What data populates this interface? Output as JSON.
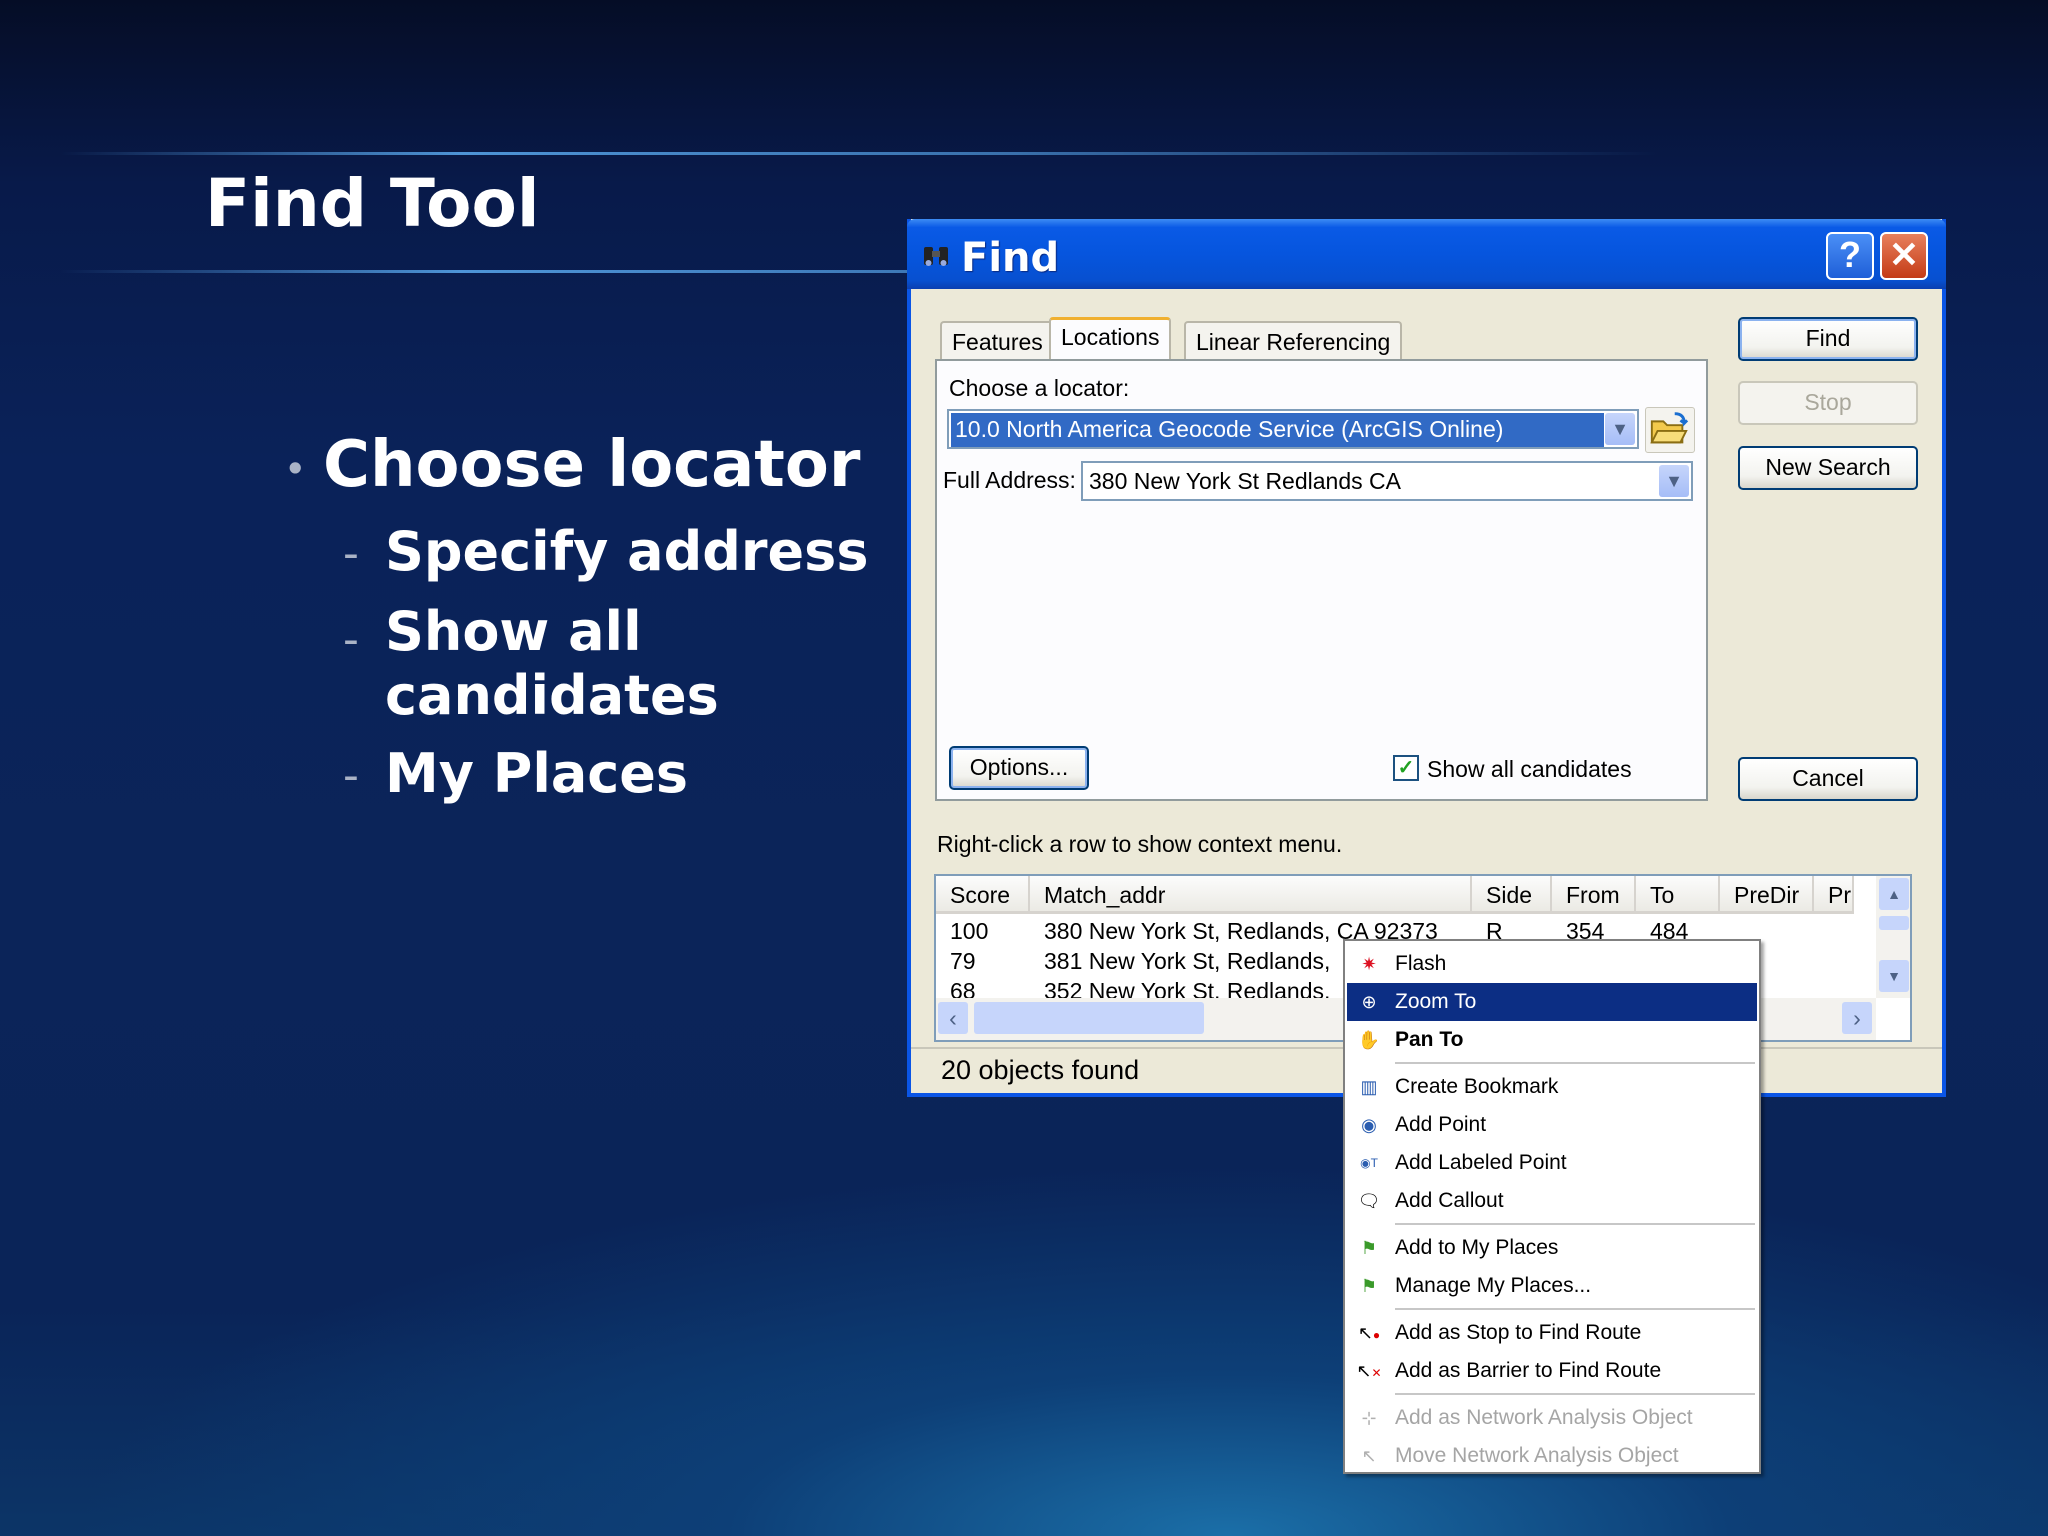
{
  "slide": {
    "title": "Find Tool",
    "bullets": {
      "main": "Choose locator",
      "sub1": "Specify address",
      "sub2a": "Show all",
      "sub2b": "candidates",
      "sub3": "My Places"
    }
  },
  "dialog": {
    "title": "Find",
    "help": "?",
    "close": "✕",
    "tabs": [
      "Features",
      "Locations",
      "Linear Referencing"
    ],
    "choose_locator_label": "Choose a locator:",
    "locator_value": "10.0 North America Geocode Service (ArcGIS Online)",
    "full_address_label": "Full Address:",
    "full_address_value": "380 New York St Redlands CA",
    "options_button": "Options...",
    "show_all_candidates": "Show all candidates",
    "show_all_checked": true,
    "buttons": {
      "find": "Find",
      "stop": "Stop",
      "new_search": "New Search",
      "cancel": "Cancel"
    },
    "hint": "Right-click a row to show context menu.",
    "columns": [
      "Score",
      "Match_addr",
      "Side",
      "From",
      "To",
      "PreDir",
      "Pre"
    ],
    "rows": [
      [
        "100",
        "380 New York St, Redlands, CA 92373",
        "R",
        "354",
        "484"
      ],
      [
        "79",
        "381 New York St, Redlands,",
        "",
        "",
        ""
      ],
      [
        "68",
        "352 New York St, Redlands,",
        "",
        "",
        ""
      ]
    ],
    "status": "20 objects found"
  },
  "context_menu": {
    "items": [
      {
        "label": "Flash",
        "icon": "flash-icon"
      },
      {
        "label": "Zoom To",
        "icon": "zoom-in-icon",
        "highlighted": true
      },
      {
        "label": "Pan To",
        "icon": "pan-hand-icon",
        "bold": true
      },
      {
        "label": "Create Bookmark",
        "icon": "bookmark-icon"
      },
      {
        "label": "Add Point",
        "icon": "point-icon"
      },
      {
        "label": "Add Labeled Point",
        "icon": "labeled-point-icon"
      },
      {
        "label": "Add Callout",
        "icon": "callout-icon"
      },
      {
        "label": "Add to My Places",
        "icon": "add-place-flag-icon"
      },
      {
        "label": "Manage My Places...",
        "icon": "place-flag-icon"
      },
      {
        "label": "Add as Stop to Find Route",
        "icon": "route-stop-icon"
      },
      {
        "label": "Add as Barrier to Find Route",
        "icon": "route-barrier-icon"
      },
      {
        "label": "Add as Network Analysis Object",
        "icon": "network-add-icon",
        "disabled": true
      },
      {
        "label": "Move Network Analysis Object",
        "icon": "network-move-icon",
        "disabled": true
      }
    ]
  },
  "colors": {
    "titlebar": "#0655de",
    "menu_highlight": "#0c2e84",
    "selection": "#316ac5"
  }
}
